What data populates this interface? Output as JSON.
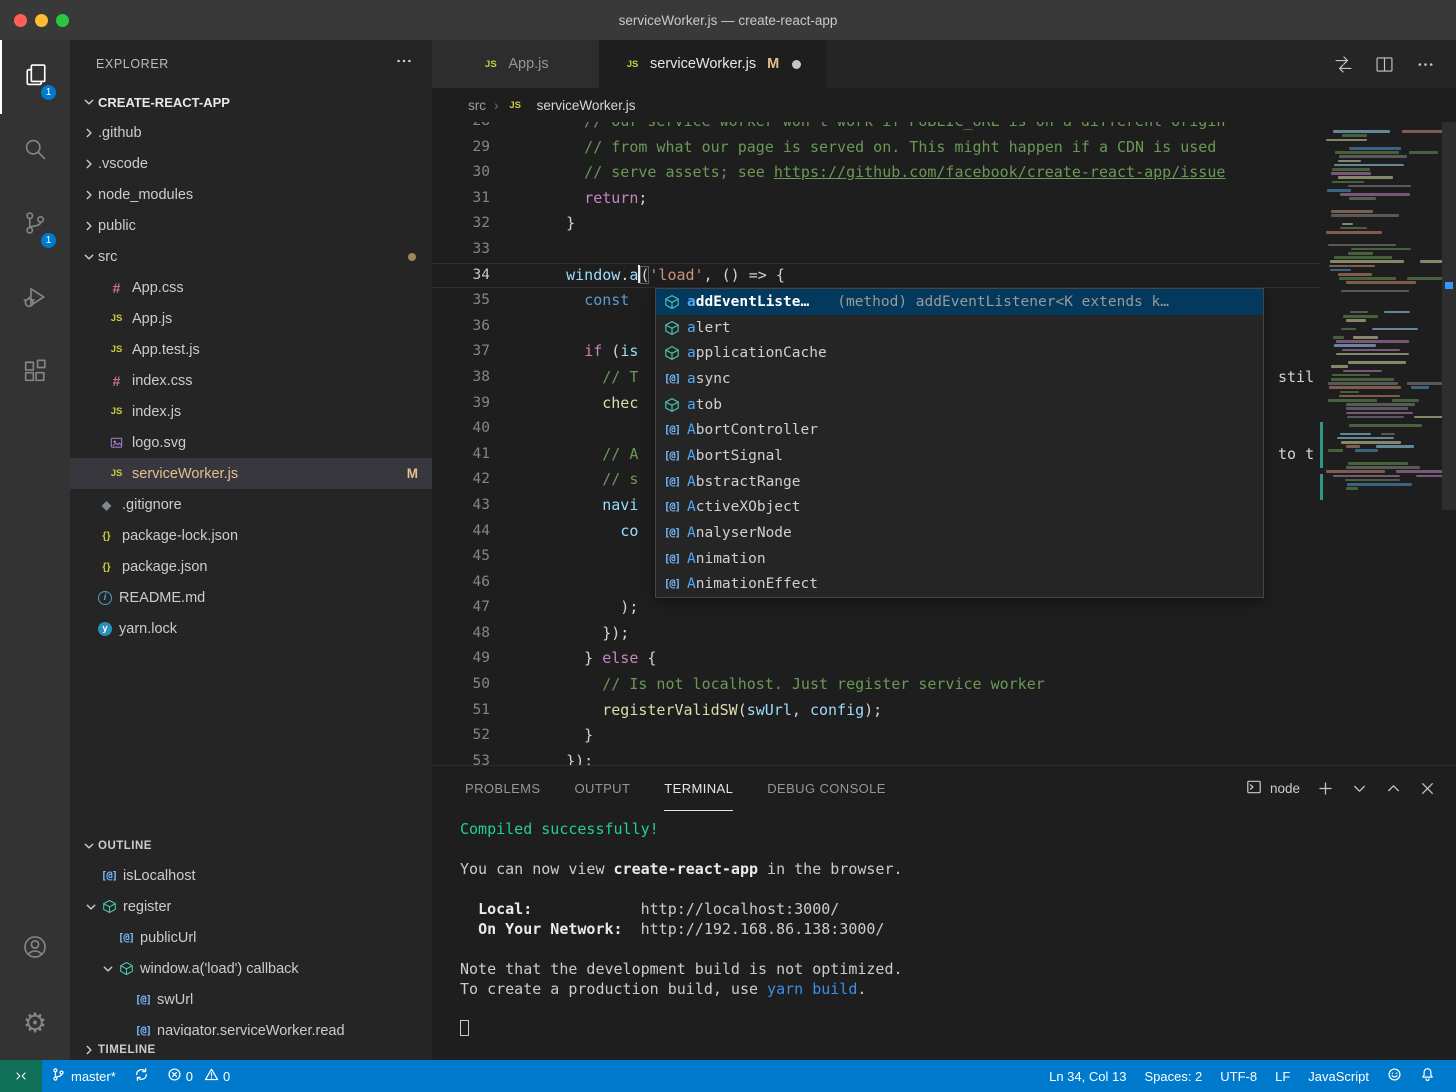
{
  "window": {
    "title": "serviceWorker.js — create-react-app"
  },
  "activity_bar": {
    "items": [
      {
        "name": "explorer",
        "active": true,
        "badge": "1"
      },
      {
        "name": "search"
      },
      {
        "name": "source-control",
        "badge": "1"
      },
      {
        "name": "run-debug"
      },
      {
        "name": "extensions"
      }
    ],
    "bottom_items": [
      {
        "name": "account"
      },
      {
        "name": "settings"
      }
    ]
  },
  "sidebar": {
    "title": "EXPLORER",
    "project": {
      "label": "CREATE-REACT-APP"
    },
    "tree": [
      {
        "label": ".github",
        "kind": "folder",
        "chevron": "right",
        "level": 0
      },
      {
        "label": ".vscode",
        "kind": "folder",
        "chevron": "right",
        "level": 0
      },
      {
        "label": "node_modules",
        "kind": "folder",
        "chevron": "right",
        "level": 0
      },
      {
        "label": "public",
        "kind": "folder",
        "chevron": "right",
        "level": 0
      },
      {
        "label": "src",
        "kind": "folder",
        "chevron": "down",
        "level": 0,
        "dot": true
      },
      {
        "label": "App.css",
        "kind": "css",
        "level": 1
      },
      {
        "label": "App.js",
        "kind": "js",
        "level": 1
      },
      {
        "label": "App.test.js",
        "kind": "js",
        "level": 1
      },
      {
        "label": "index.css",
        "kind": "css",
        "level": 1
      },
      {
        "label": "index.js",
        "kind": "js",
        "level": 1
      },
      {
        "label": "logo.svg",
        "kind": "svg",
        "level": 1
      },
      {
        "label": "serviceWorker.js",
        "kind": "js",
        "level": 1,
        "selected": true,
        "badge": "M",
        "modified": true
      },
      {
        "label": ".gitignore",
        "kind": "git",
        "level": 0,
        "file": true
      },
      {
        "label": "package-lock.json",
        "kind": "json",
        "level": 0,
        "file": true
      },
      {
        "label": "package.json",
        "kind": "json",
        "level": 0,
        "file": true
      },
      {
        "label": "README.md",
        "kind": "readme",
        "level": 0,
        "file": true
      },
      {
        "label": "yarn.lock",
        "kind": "yarn",
        "level": 0,
        "file": true
      }
    ],
    "outline": {
      "title": "OUTLINE",
      "items": [
        {
          "label": "isLocalhost",
          "kind": "variable",
          "level": 0,
          "chevron": "none"
        },
        {
          "label": "register",
          "kind": "method",
          "level": 0,
          "chevron": "down"
        },
        {
          "label": "publicUrl",
          "kind": "variable",
          "level": 1,
          "chevron": "none"
        },
        {
          "label": "window.a('load') callback",
          "kind": "method",
          "level": 1,
          "chevron": "down"
        },
        {
          "label": "swUrl",
          "kind": "variable",
          "level": 2,
          "chevron": "none"
        },
        {
          "label": "navigator.serviceWorker.read",
          "kind": "variable",
          "level": 2,
          "chevron": "none"
        }
      ]
    },
    "timeline": {
      "title": "TIMELINE"
    }
  },
  "editor": {
    "tabs": [
      {
        "label": "App.js",
        "icon": "js",
        "active": false
      },
      {
        "label": "serviceWorker.js",
        "icon": "js",
        "active": true,
        "git_badge": "M",
        "dirty": true
      }
    ],
    "breadcrumb": {
      "parent": "src",
      "file": "serviceWorker.js"
    },
    "lines": [
      {
        "n": 28,
        "segs": [
          {
            "c": "cm",
            "t": "      // our service worker won't work if PUBLIC_URL is on a different origin"
          }
        ]
      },
      {
        "n": 29,
        "segs": [
          {
            "c": "cm",
            "t": "      // from what our page is served on. This might happen if a CDN is used"
          }
        ]
      },
      {
        "n": 30,
        "segs": [
          {
            "c": "cm",
            "t": "      // serve assets; see "
          },
          {
            "c": "link",
            "t": "https://github.com/facebook/create-react-app/issue"
          }
        ]
      },
      {
        "n": 31,
        "segs": [
          {
            "c": "tx",
            "t": "      "
          },
          {
            "c": "kw",
            "t": "return"
          },
          {
            "c": "tx",
            "t": ";"
          }
        ]
      },
      {
        "n": 32,
        "segs": [
          {
            "c": "tx",
            "t": "    }"
          }
        ]
      },
      {
        "n": 33,
        "segs": []
      },
      {
        "n": 34,
        "current": true,
        "segs": [
          {
            "c": "tx",
            "t": "    "
          },
          {
            "c": "vr",
            "t": "window"
          },
          {
            "c": "tx",
            "t": "."
          },
          {
            "c": "vr",
            "t": "a"
          },
          {
            "c": "cursor",
            "t": ""
          },
          {
            "c": "bm",
            "t": "("
          },
          {
            "c": "str",
            "t": "'load'"
          },
          {
            "c": "tx",
            "t": ", () => {"
          }
        ]
      },
      {
        "n": 35,
        "segs": [
          {
            "c": "tx",
            "t": "      "
          },
          {
            "c": "decl",
            "t": "const"
          }
        ]
      },
      {
        "n": 36,
        "segs": []
      },
      {
        "n": 37,
        "segs": [
          {
            "c": "tx",
            "t": "      "
          },
          {
            "c": "kw",
            "t": "if"
          },
          {
            "c": "tx",
            "t": " ("
          },
          {
            "c": "vr",
            "t": "is"
          }
        ]
      },
      {
        "n": 38,
        "segs": [
          {
            "c": "cm",
            "t": "        // T"
          }
        ],
        "right": "stil"
      },
      {
        "n": 39,
        "segs": [
          {
            "c": "tx",
            "t": "        "
          },
          {
            "c": "fn",
            "t": "chec"
          }
        ]
      },
      {
        "n": 40,
        "segs": []
      },
      {
        "n": 41,
        "segs": [
          {
            "c": "cm",
            "t": "        // A"
          }
        ],
        "right": "to t"
      },
      {
        "n": 42,
        "segs": [
          {
            "c": "cm",
            "t": "        // s"
          }
        ]
      },
      {
        "n": 43,
        "segs": [
          {
            "c": "tx",
            "t": "        "
          },
          {
            "c": "vr",
            "t": "navi"
          }
        ]
      },
      {
        "n": 44,
        "segs": [
          {
            "c": "tx",
            "t": "          "
          },
          {
            "c": "vr",
            "t": "co"
          }
        ]
      },
      {
        "n": 45,
        "segs": []
      },
      {
        "n": 46,
        "segs": []
      },
      {
        "n": 47,
        "segs": [
          {
            "c": "tx",
            "t": "          );"
          }
        ]
      },
      {
        "n": 48,
        "segs": [
          {
            "c": "tx",
            "t": "        });"
          }
        ]
      },
      {
        "n": 49,
        "segs": [
          {
            "c": "tx",
            "t": "      } "
          },
          {
            "c": "kw",
            "t": "else"
          },
          {
            "c": "tx",
            "t": " {"
          }
        ]
      },
      {
        "n": 50,
        "segs": [
          {
            "c": "cm",
            "t": "        // Is not localhost. Just register service worker"
          }
        ]
      },
      {
        "n": 51,
        "segs": [
          {
            "c": "tx",
            "t": "        "
          },
          {
            "c": "fn",
            "t": "registerValidSW"
          },
          {
            "c": "tx",
            "t": "("
          },
          {
            "c": "vr",
            "t": "swUrl"
          },
          {
            "c": "tx",
            "t": ", "
          },
          {
            "c": "vr",
            "t": "config"
          },
          {
            "c": "tx",
            "t": ");"
          }
        ]
      },
      {
        "n": 52,
        "segs": [
          {
            "c": "tx",
            "t": "      }"
          }
        ]
      },
      {
        "n": 53,
        "segs": [
          {
            "c": "tx",
            "t": "    });"
          }
        ]
      }
    ],
    "suggest": {
      "items": [
        {
          "label": "addEventListe…",
          "kind": "method",
          "selected": true,
          "detail": "(method) addEventListener<K extends k…",
          "match_len": 1
        },
        {
          "label": "alert",
          "kind": "method",
          "match_len": 1
        },
        {
          "label": "applicationCache",
          "kind": "method",
          "match_len": 1
        },
        {
          "label": "async",
          "kind": "variable",
          "match_len": 1
        },
        {
          "label": "atob",
          "kind": "method",
          "match_len": 1
        },
        {
          "label": "AbortController",
          "kind": "variable",
          "match_len": 1
        },
        {
          "label": "AbortSignal",
          "kind": "variable",
          "match_len": 1
        },
        {
          "label": "AbstractRange",
          "kind": "variable",
          "match_len": 1
        },
        {
          "label": "ActiveXObject",
          "kind": "variable",
          "match_len": 1
        },
        {
          "label": "AnalyserNode",
          "kind": "variable",
          "match_len": 1
        },
        {
          "label": "Animation",
          "kind": "variable",
          "match_len": 1
        },
        {
          "label": "AnimationEffect",
          "kind": "variable",
          "match_len": 1
        }
      ]
    }
  },
  "panel": {
    "tabs": [
      {
        "label": "PROBLEMS"
      },
      {
        "label": "OUTPUT"
      },
      {
        "label": "TERMINAL",
        "active": true
      },
      {
        "label": "DEBUG CONSOLE"
      }
    ],
    "picker": {
      "label": "node"
    },
    "terminal": [
      [
        {
          "c": "ok",
          "t": "Compiled successfully!"
        }
      ],
      [],
      [
        {
          "t": "You can now view "
        },
        {
          "c": "b",
          "t": "create-react-app"
        },
        {
          "t": " in the browser."
        }
      ],
      [],
      [
        {
          "t": "  "
        },
        {
          "c": "b",
          "t": "Local:"
        },
        {
          "t": "            http://localhost:3000/"
        }
      ],
      [
        {
          "t": "  "
        },
        {
          "c": "b",
          "t": "On Your Network:"
        },
        {
          "t": "  http://192.168.86.138:3000/"
        }
      ],
      [],
      [
        {
          "t": "Note that the development build is not optimized."
        }
      ],
      [
        {
          "t": "To create a production build, use "
        },
        {
          "c": "yarn",
          "t": "yarn build"
        },
        {
          "t": "."
        }
      ],
      [],
      [
        {
          "c": "cursor",
          "t": ""
        }
      ]
    ]
  },
  "status_bar": {
    "left": [
      {
        "name": "remote-indicator",
        "icon": "remote"
      },
      {
        "name": "git-branch",
        "icon": "branch",
        "label": "master*"
      },
      {
        "name": "sync",
        "icon": "sync"
      },
      {
        "name": "problems",
        "parts": [
          {
            "icon": "error",
            "label": "0"
          },
          {
            "icon": "warning",
            "label": "0"
          }
        ]
      }
    ],
    "right": [
      {
        "name": "cursor-position",
        "label": "Ln 34, Col 13"
      },
      {
        "name": "indentation",
        "label": "Spaces: 2"
      },
      {
        "name": "encoding",
        "label": "UTF-8"
      },
      {
        "name": "eol",
        "label": "LF"
      },
      {
        "name": "language-mode",
        "label": "JavaScript"
      },
      {
        "name": "feedback",
        "icon": "smiley"
      },
      {
        "name": "notifications",
        "icon": "bell"
      }
    ]
  }
}
